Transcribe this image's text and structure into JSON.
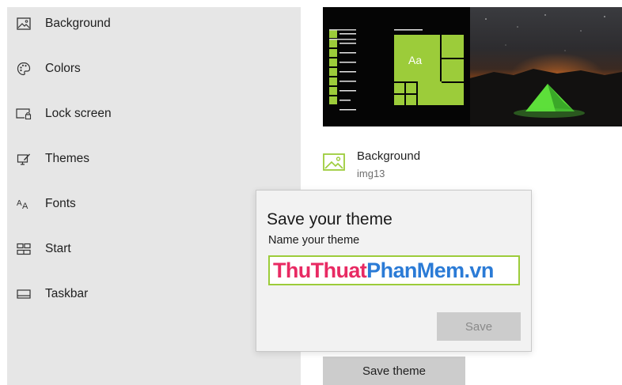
{
  "sidebar": {
    "items": [
      {
        "label": "Background",
        "icon": "picture-icon"
      },
      {
        "label": "Colors",
        "icon": "palette-icon"
      },
      {
        "label": "Lock screen",
        "icon": "lock-screen-icon"
      },
      {
        "label": "Themes",
        "icon": "themes-icon"
      },
      {
        "label": "Fonts",
        "icon": "fonts-icon"
      },
      {
        "label": "Start",
        "icon": "start-tiles-icon"
      },
      {
        "label": "Taskbar",
        "icon": "taskbar-icon"
      }
    ]
  },
  "preview": {
    "tile_label": "Aa",
    "accent_color": "#9ccc3a"
  },
  "background_info": {
    "title": "Background",
    "value": "img13"
  },
  "save_theme_button": "Save theme",
  "dialog": {
    "title": "Save your theme",
    "label": "Name your theme",
    "input_value_part1": "ThuThuat",
    "input_value_part2": "PhanMem.vn",
    "save_label": "Save",
    "input_border_color": "#9ccc3a"
  }
}
